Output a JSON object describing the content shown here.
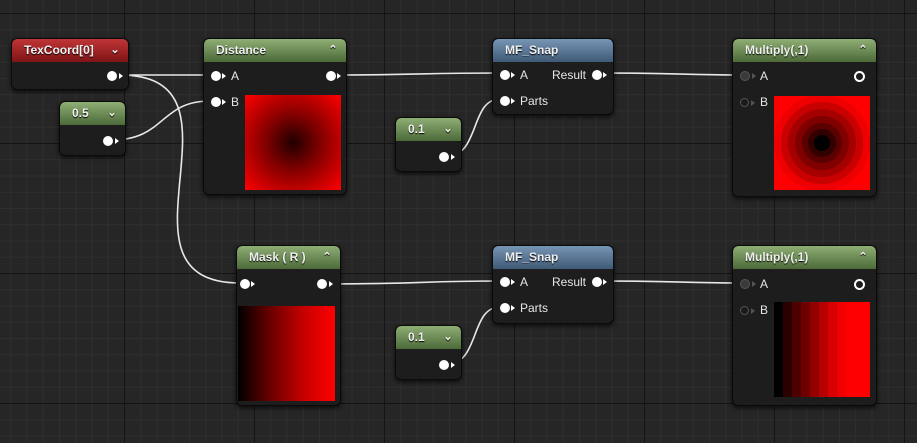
{
  "nodes": {
    "texcoord": {
      "title": "TexCoord[0]",
      "chevron": "chevron-down-icon"
    },
    "const1": {
      "title": "0.5",
      "chevron": "chevron-down-icon"
    },
    "distance": {
      "title": "Distance",
      "chevron": "chevron-up-icon",
      "pin_a": "A",
      "pin_b": "B"
    },
    "snap1": {
      "title": "MF_Snap",
      "pin_a": "A",
      "pin_parts": "Parts",
      "pin_result": "Result"
    },
    "const2": {
      "title": "0.1",
      "chevron": "chevron-down-icon"
    },
    "multiply1": {
      "title": "Multiply(,1)",
      "chevron": "chevron-up-icon",
      "pin_a": "A",
      "pin_b": "B"
    },
    "mask": {
      "title": "Mask ( R )",
      "chevron": "chevron-up-icon"
    },
    "snap2": {
      "title": "MF_Snap",
      "pin_a": "A",
      "pin_parts": "Parts",
      "pin_result": "Result"
    },
    "const3": {
      "title": "0.1",
      "chevron": "chevron-down-icon"
    },
    "multiply2": {
      "title": "Multiply(,1)",
      "chevron": "chevron-up-icon",
      "pin_a": "A",
      "pin_b": "B"
    }
  },
  "icons": {
    "down": "⌄",
    "up": "⌃"
  },
  "colors": {
    "texcoord_header": "#a8282a",
    "constant_header": "#6f8f55",
    "function_header": "#5d7b99",
    "math_header": "#7d9868",
    "preview_red": "#ff0000"
  }
}
